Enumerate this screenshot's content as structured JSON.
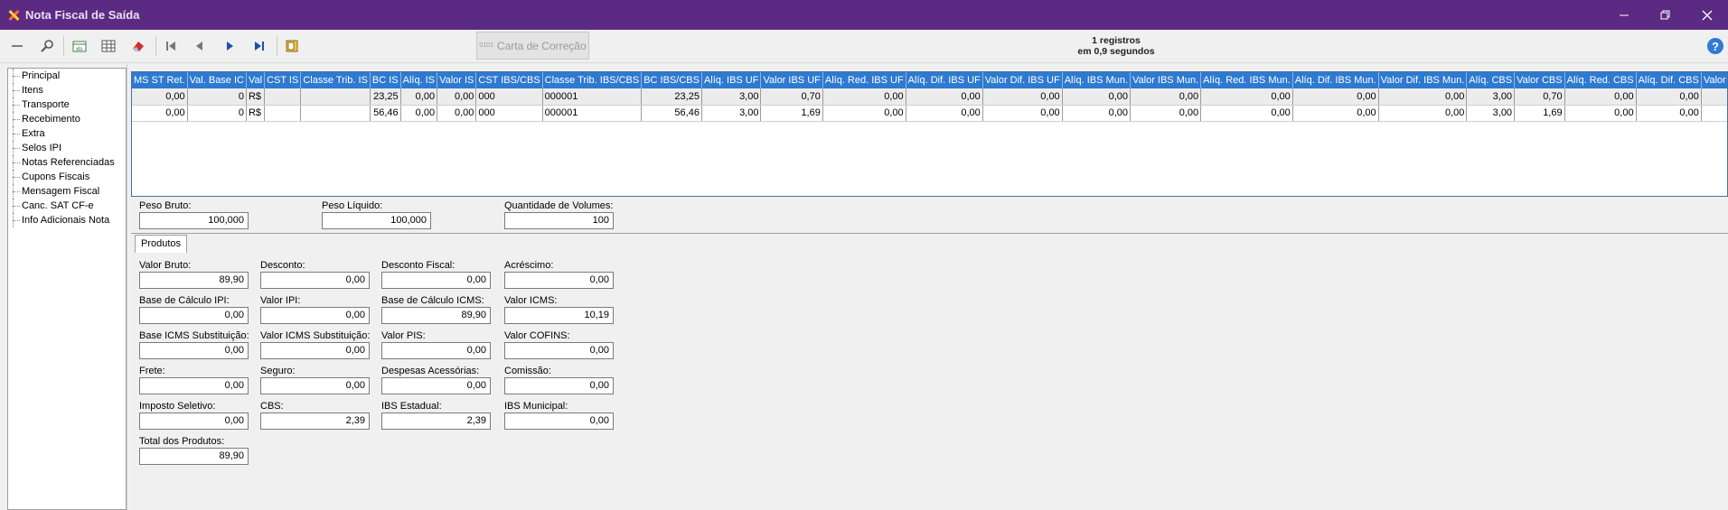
{
  "window": {
    "title": "Nota Fiscal de Saída"
  },
  "toolbar": {
    "carta_button": "Carta de Correção",
    "carta_mini": "0101",
    "records_line1": "1 registros",
    "records_line2": "em 0,9 segundos",
    "help": "?"
  },
  "tree": [
    "Principal",
    "Itens",
    "Transporte",
    "Recebimento",
    "Extra",
    "Selos IPI",
    "Notas Referenciadas",
    "Cupons Fiscais",
    "Mensagem Fiscal",
    "Canc. SAT CF-e",
    "Info Adicionais Nota"
  ],
  "grid": {
    "columns": [
      "MS ST Ret.",
      "Val. Base IC",
      "Val",
      "CST IS",
      "Classe Trib. IS",
      "BC IS",
      "Alíq. IS",
      "Valor IS",
      "CST IBS/CBS",
      "Classe Trib. IBS/CBS",
      "BC IBS/CBS",
      "Alíq. IBS UF",
      "Valor IBS UF",
      "Alíq. Red. IBS UF",
      "Alíq. Dif. IBS UF",
      "Valor Dif. IBS UF",
      "Alíq. IBS Mun.",
      "Valor IBS Mun.",
      "Alíq. Red. IBS Mun.",
      "Alíq. Dif. IBS Mun.",
      "Valor Dif. IBS Mun.",
      "Alíq. CBS",
      "Valor CBS",
      "Alíq. Red. CBS",
      "Alíq. Dif. CBS",
      "Valor Dif. CBS"
    ],
    "rows": [
      [
        "0,00",
        "0",
        "R$",
        "",
        "",
        "23,25",
        "0,00",
        "0,00",
        "000",
        "000001",
        "23,25",
        "3,00",
        "0,70",
        "0,00",
        "0,00",
        "0,00",
        "0,00",
        "0,00",
        "0,00",
        "0,00",
        "0,00",
        "3,00",
        "0,70",
        "0,00",
        "0,00",
        "0,00"
      ],
      [
        "0,00",
        "0",
        "R$",
        "",
        "",
        "56,46",
        "0,00",
        "0,00",
        "000",
        "000001",
        "56,46",
        "3,00",
        "1,69",
        "0,00",
        "0,00",
        "0,00",
        "0,00",
        "0,00",
        "0,00",
        "0,00",
        "0,00",
        "3,00",
        "1,69",
        "0,00",
        "0,00",
        "0,00"
      ]
    ]
  },
  "peso": {
    "bruto_label": "Peso Bruto:",
    "bruto_value": "100,000",
    "liquido_label": "Peso Líquido:",
    "liquido_value": "100,000",
    "volumes_label": "Quantidade de Volumes:",
    "volumes_value": "100"
  },
  "tabs": {
    "produtos": "Produtos"
  },
  "produtos": {
    "valor_bruto": {
      "label": "Valor Bruto:",
      "value": "89,90"
    },
    "desconto": {
      "label": "Desconto:",
      "value": "0,00"
    },
    "desconto_fiscal": {
      "label": "Desconto Fiscal:",
      "value": "0,00"
    },
    "acrescimo": {
      "label": "Acréscimo:",
      "value": "0,00"
    },
    "base_ipi": {
      "label": "Base de Cálculo IPI:",
      "value": "0,00"
    },
    "valor_ipi": {
      "label": "Valor IPI:",
      "value": "0,00"
    },
    "base_icms": {
      "label": "Base de Cálculo ICMS:",
      "value": "89,90"
    },
    "valor_icms": {
      "label": "Valor ICMS:",
      "value": "10,19"
    },
    "base_icms_st": {
      "label": "Base ICMS Substituição:",
      "value": "0,00"
    },
    "valor_icms_st": {
      "label": "Valor ICMS Substituição:",
      "value": "0,00"
    },
    "valor_pis": {
      "label": "Valor PIS:",
      "value": "0,00"
    },
    "valor_cofins": {
      "label": "Valor COFINS:",
      "value": "0,00"
    },
    "frete": {
      "label": "Frete:",
      "value": "0,00"
    },
    "seguro": {
      "label": "Seguro:",
      "value": "0,00"
    },
    "despesas": {
      "label": "Despesas Acessórias:",
      "value": "0,00"
    },
    "comissao": {
      "label": "Comissão:",
      "value": "0,00"
    },
    "imposto_seletivo": {
      "label": "Imposto Seletivo:",
      "value": "0,00"
    },
    "cbs": {
      "label": "CBS:",
      "value": "2,39"
    },
    "ibs_estadual": {
      "label": "IBS Estadual:",
      "value": "2,39"
    },
    "ibs_municipal": {
      "label": "IBS Municipal:",
      "value": "0,00"
    },
    "total_produtos": {
      "label": "Total dos Produtos:",
      "value": "89,90"
    }
  }
}
